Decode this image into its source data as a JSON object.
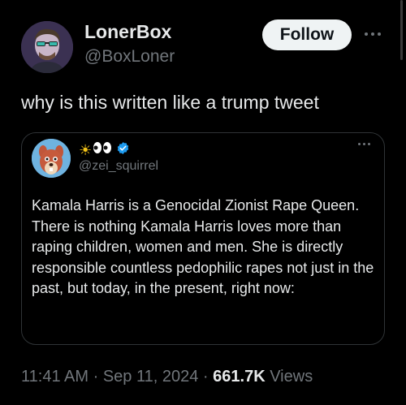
{
  "author": {
    "display_name": "LonerBox",
    "handle": "@BoxLoner",
    "avatar_icon": "profile-photo"
  },
  "actions": {
    "follow_label": "Follow",
    "more_icon": "ellipsis-icon"
  },
  "tweet": {
    "text": "why is this written like a trump tweet"
  },
  "quoted": {
    "display_emoji_sun": "☀",
    "display_emoji_eyes": "👀",
    "verified_icon": "verified-badge-icon",
    "verified_color": "#1d9bf0",
    "handle": "@zei_squirrel",
    "text": "Kamala Harris is a Genocidal Zionist Rape Queen. There is nothing Kamala Harris loves more than raping children, women and men. She is directly responsible countless pedophilic rapes not just in the past, but today, in the present, right now:"
  },
  "meta": {
    "time": "11:41 AM",
    "separator": "·",
    "date": "Sep 11, 2024",
    "views_count": "661.7K",
    "views_label": "Views"
  },
  "colors": {
    "background": "#000000",
    "text_primary": "#e7e9ea",
    "text_secondary": "#71767b",
    "border": "#2f3336",
    "follow_bg": "#eff3f4"
  }
}
